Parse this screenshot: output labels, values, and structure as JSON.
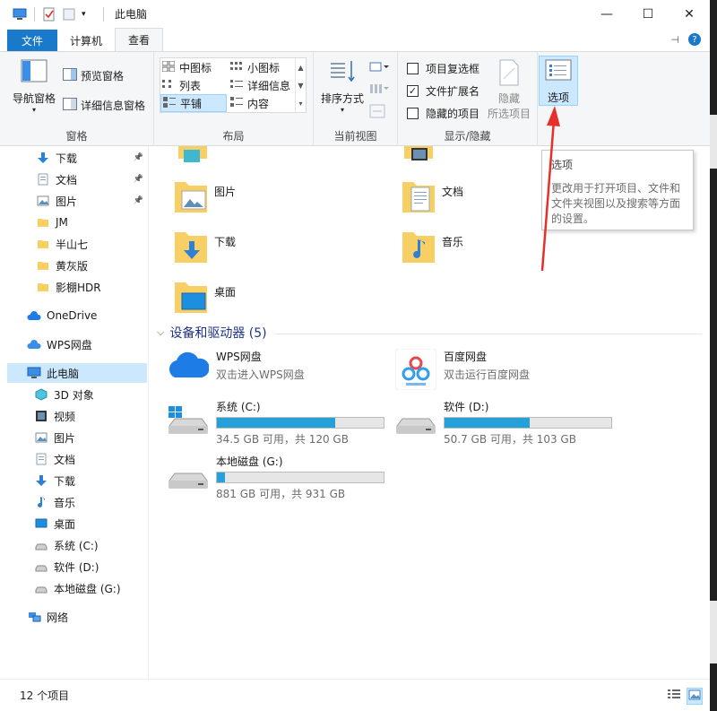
{
  "window": {
    "title": "此电脑"
  },
  "tabs": {
    "file": "文件",
    "computer": "计算机",
    "view": "查看"
  },
  "ribbon": {
    "panes": {
      "nav_pane": "导航窗格",
      "preview_pane": "预览窗格",
      "details_pane": "详细信息窗格",
      "label": "窗格"
    },
    "layout": {
      "items": [
        "中图标",
        "小图标",
        "列表",
        "详细信息",
        "平铺",
        "内容"
      ],
      "selected": "平铺",
      "label": "布局"
    },
    "current_view": {
      "sort": "排序方式",
      "label": "当前视图"
    },
    "show_hide": {
      "item_checkboxes": "项目复选框",
      "file_extensions": "文件扩展名",
      "hidden_items": "隐藏的项目",
      "hide_selected_line1": "隐藏",
      "hide_selected_line2": "所选项目",
      "label": "显示/隐藏",
      "item_checkboxes_checked": false,
      "file_extensions_checked": true,
      "hidden_items_checked": false
    },
    "options": {
      "label": "选项"
    }
  },
  "nav": {
    "items": [
      {
        "label": "下载",
        "icon": "download-arrow-icon",
        "pinned": true
      },
      {
        "label": "文档",
        "icon": "document-icon",
        "pinned": true
      },
      {
        "label": "图片",
        "icon": "picture-icon",
        "pinned": true
      },
      {
        "label": "JM",
        "icon": "folder-icon"
      },
      {
        "label": "半山七",
        "icon": "folder-icon"
      },
      {
        "label": "黄灰版",
        "icon": "folder-icon"
      },
      {
        "label": "影棚HDR",
        "icon": "folder-icon"
      },
      {
        "label": "OneDrive",
        "icon": "cloud-icon"
      },
      {
        "label": "WPS网盘",
        "icon": "wps-cloud-icon"
      },
      {
        "label": "此电脑",
        "icon": "computer-icon",
        "selected": true
      },
      {
        "label": "3D 对象",
        "icon": "cube-icon"
      },
      {
        "label": "视频",
        "icon": "video-icon"
      },
      {
        "label": "图片",
        "icon": "picture-icon"
      },
      {
        "label": "文档",
        "icon": "document-icon"
      },
      {
        "label": "下载",
        "icon": "download-arrow-icon"
      },
      {
        "label": "音乐",
        "icon": "music-icon"
      },
      {
        "label": "桌面",
        "icon": "desktop-icon"
      },
      {
        "label": "系统 (C:)",
        "icon": "drive-icon"
      },
      {
        "label": "软件 (D:)",
        "icon": "drive-icon"
      },
      {
        "label": "本地磁盘 (G:)",
        "icon": "drive-icon"
      },
      {
        "label": "网络",
        "icon": "network-icon"
      }
    ]
  },
  "folders": [
    {
      "label": "图片"
    },
    {
      "label": "文档"
    },
    {
      "label": "下载"
    },
    {
      "label": "音乐"
    },
    {
      "label": "桌面"
    }
  ],
  "devices": {
    "heading": "设备和驱动器 (5)",
    "items": [
      {
        "name": "WPS网盘",
        "sub": "双击进入WPS网盘"
      },
      {
        "name": "百度网盘",
        "sub": "双击运行百度网盘"
      },
      {
        "name": "系统 (C:)",
        "sub": "34.5 GB 可用，共 120 GB",
        "used_fraction": 0.71
      },
      {
        "name": "软件 (D:)",
        "sub": "50.7 GB 可用，共 103 GB",
        "used_fraction": 0.51
      },
      {
        "name": "本地磁盘 (G:)",
        "sub": "881 GB 可用，共 931 GB",
        "used_fraction": 0.05
      }
    ]
  },
  "tooltip": {
    "title": "选项",
    "body": "更改用于打开项目、文件和文件夹视图以及搜索等方面的设置。"
  },
  "status": {
    "count": "12 个项目"
  },
  "colors": {
    "accent": "#1979ca",
    "drive_bar": "#26a0da",
    "selection": "#cce8ff",
    "annotation_arrow": "#e8302a"
  }
}
